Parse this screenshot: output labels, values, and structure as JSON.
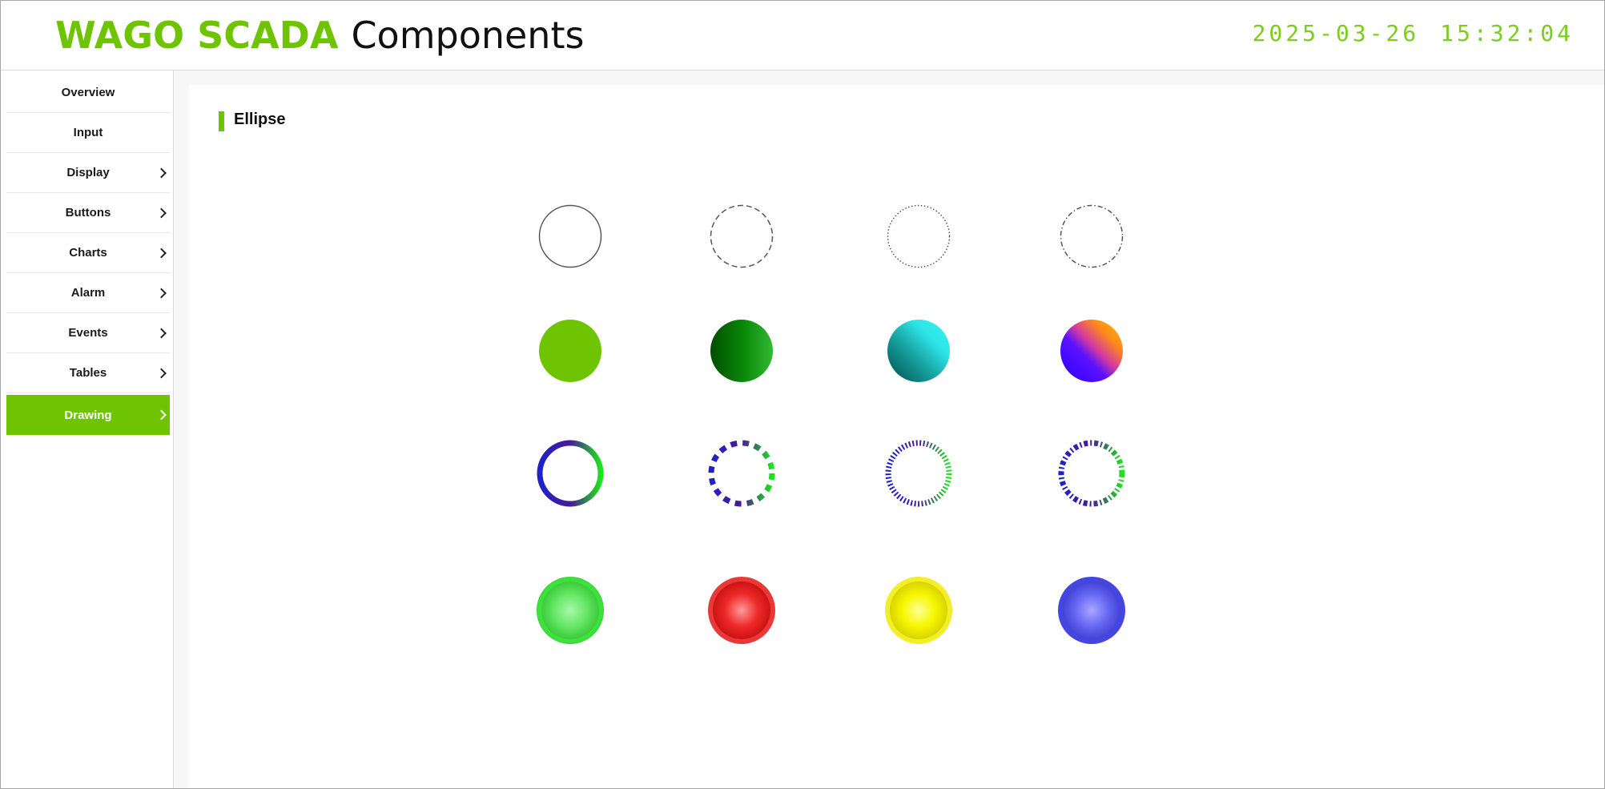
{
  "header": {
    "brand": "WAGO SCADA",
    "suffix": "Components",
    "date": "2025-03-26",
    "time": "15:32:04"
  },
  "sidebar": {
    "items": [
      {
        "label": "Overview",
        "has_submenu": false
      },
      {
        "label": "Input",
        "has_submenu": false
      },
      {
        "label": "Display",
        "has_submenu": true
      },
      {
        "label": "Buttons",
        "has_submenu": true
      },
      {
        "label": "Charts",
        "has_submenu": true
      },
      {
        "label": "Alarm",
        "has_submenu": true
      },
      {
        "label": "Events",
        "has_submenu": true
      },
      {
        "label": "Tables",
        "has_submenu": true
      },
      {
        "label": "Drawing",
        "has_submenu": true,
        "active": true
      }
    ]
  },
  "section": {
    "title": "Ellipse"
  },
  "colors": {
    "accent": "#6ec401",
    "clock": "#7ccd1c"
  },
  "ellipses": {
    "outline_styles": [
      "solid",
      "dashed",
      "dotted",
      "dash-dot"
    ],
    "fills": [
      "solid-green",
      "dark-green-gradient",
      "cyan-teal-gradient",
      "blue-purple-orange-gradient"
    ],
    "gradient_rings": [
      "solid-ring",
      "dashed-ring",
      "fine-dashed-ring",
      "mixed-dashed-ring"
    ],
    "indicator_lamps": [
      "green",
      "red",
      "yellow",
      "blue"
    ]
  }
}
